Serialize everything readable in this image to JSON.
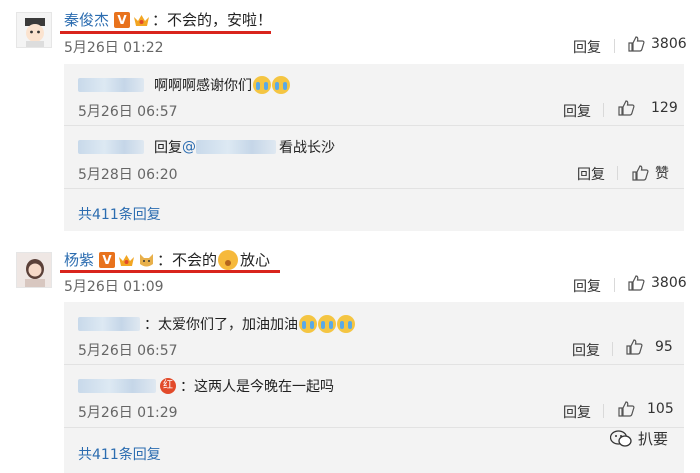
{
  "comments": [
    {
      "user": "秦俊杰",
      "verified": "V",
      "text": "：不会的，安啦！",
      "time": "5月26日 01:22",
      "reply_label": "回复",
      "likes": "3806",
      "replies": [
        {
          "text": "啊啊啊感谢你们",
          "time": "5月26日 06:57",
          "reply_label": "回复",
          "likes": "129"
        },
        {
          "prefix": "回复",
          "mention": "@",
          "text": "看战长沙",
          "time": "5月28日 06:20",
          "reply_label": "回复",
          "likes": "赞"
        }
      ],
      "more": "共411条回复"
    },
    {
      "user": "杨紫",
      "verified": "V",
      "text": "：不会的",
      "text2": "放心",
      "time": "5月26日 01:09",
      "reply_label": "回复",
      "likes": "3806",
      "replies": [
        {
          "text": "：太爱你们了，加油加油",
          "time": "5月26日 06:57",
          "reply_label": "回复",
          "likes": "95"
        },
        {
          "badge": "红",
          "text": "：这两人是今晚在一起吗",
          "time": "5月26日 01:29",
          "reply_label": "回复",
          "likes": "105"
        }
      ],
      "more": "共411条回复"
    }
  ],
  "watermark": "扒要",
  "colors": {
    "link": "#2b6cb0",
    "underline": "#d9241c",
    "verified": "#e8721c",
    "reply_bg": "#f3f3f3"
  }
}
